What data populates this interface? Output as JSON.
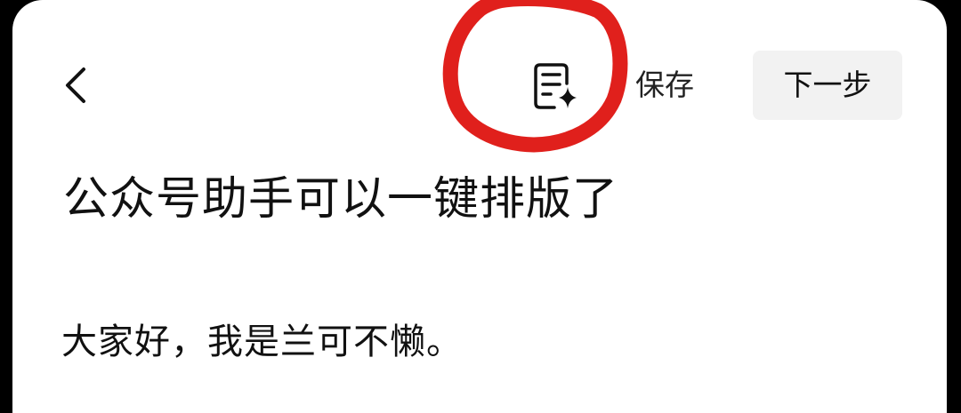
{
  "toolbar": {
    "back_icon": "chevron-left-icon",
    "ai_format_icon": "document-sparkle-icon",
    "save_label": "保存",
    "next_label": "下一步"
  },
  "article": {
    "title": "公众号助手可以一键排版了",
    "body": "大家好，我是兰可不懒。"
  },
  "annotation": {
    "type": "hand-drawn red circle around format button",
    "color": "#e0201c"
  },
  "colors": {
    "background": "#ffffff",
    "next_button_bg": "#f2f2f2",
    "text": "#111111"
  }
}
